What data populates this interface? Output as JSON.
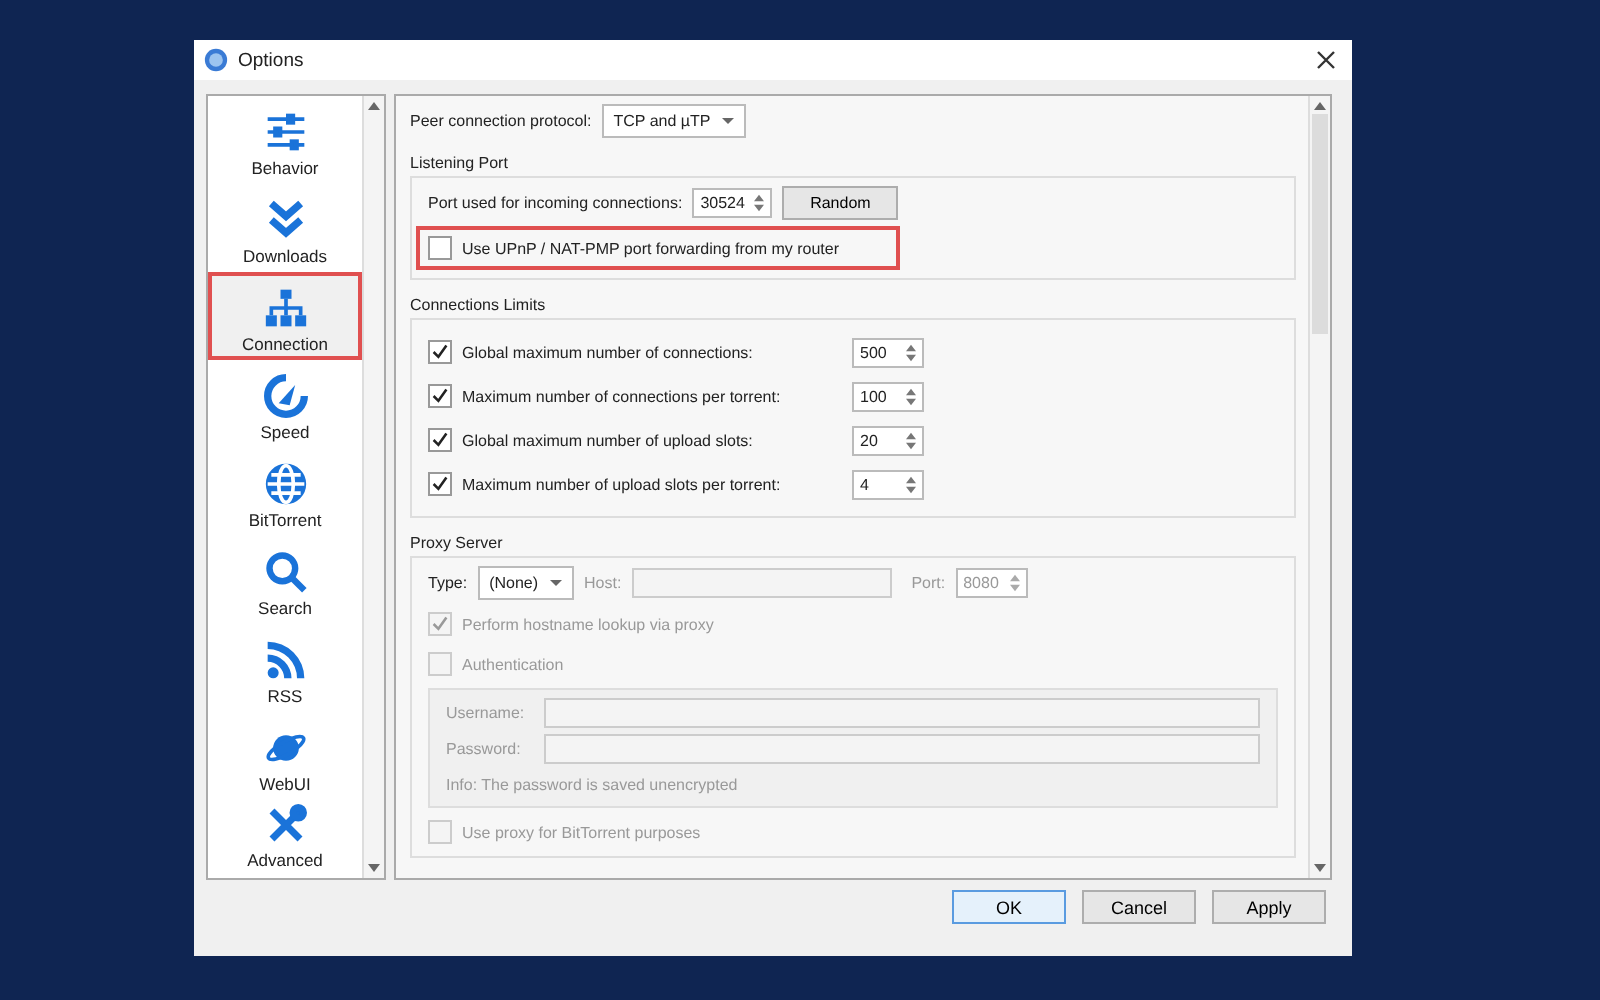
{
  "window": {
    "title": "Options"
  },
  "sidebar": {
    "items": [
      {
        "label": "Behavior",
        "selected": false,
        "highlighted": false
      },
      {
        "label": "Downloads",
        "selected": false,
        "highlighted": false
      },
      {
        "label": "Connection",
        "selected": true,
        "highlighted": true
      },
      {
        "label": "Speed",
        "selected": false,
        "highlighted": false
      },
      {
        "label": "BitTorrent",
        "selected": false,
        "highlighted": false
      },
      {
        "label": "Search",
        "selected": false,
        "highlighted": false
      },
      {
        "label": "RSS",
        "selected": false,
        "highlighted": false
      },
      {
        "label": "WebUI",
        "selected": false,
        "highlighted": false
      },
      {
        "label": "Advanced",
        "selected": false,
        "highlighted": false
      }
    ]
  },
  "peer_protocol": {
    "label": "Peer connection protocol:",
    "value": "TCP and µTP"
  },
  "listening_port": {
    "title": "Listening Port",
    "port_label": "Port used for incoming connections:",
    "port_value": "30524",
    "random_button": "Random",
    "upnp": {
      "label": "Use UPnP / NAT-PMP port forwarding from my router",
      "checked": false,
      "highlighted": true
    }
  },
  "connection_limits": {
    "title": "Connections Limits",
    "rows": [
      {
        "label": "Global maximum number of connections:",
        "checked": true,
        "value": "500"
      },
      {
        "label": "Maximum number of connections per torrent:",
        "checked": true,
        "value": "100"
      },
      {
        "label": "Global maximum number of upload slots:",
        "checked": true,
        "value": "20"
      },
      {
        "label": "Maximum number of upload slots per torrent:",
        "checked": true,
        "value": "4"
      }
    ]
  },
  "proxy": {
    "title": "Proxy Server",
    "disabled": true,
    "type_label": "Type:",
    "type_value": "(None)",
    "host_label": "Host:",
    "port_label": "Port:",
    "port_value": "8080",
    "hostname_lookup": {
      "label": "Perform hostname lookup via proxy",
      "checked": true
    },
    "authentication": {
      "label": "Authentication",
      "checked": false
    },
    "username_label": "Username:",
    "password_label": "Password:",
    "info": "Info: The password is saved unencrypted",
    "bittorrent_proxy": {
      "label": "Use proxy for BitTorrent purposes",
      "checked": false
    }
  },
  "buttons": [
    {
      "label": "OK",
      "default": true
    },
    {
      "label": "Cancel",
      "default": false
    },
    {
      "label": "Apply",
      "default": false
    }
  ]
}
